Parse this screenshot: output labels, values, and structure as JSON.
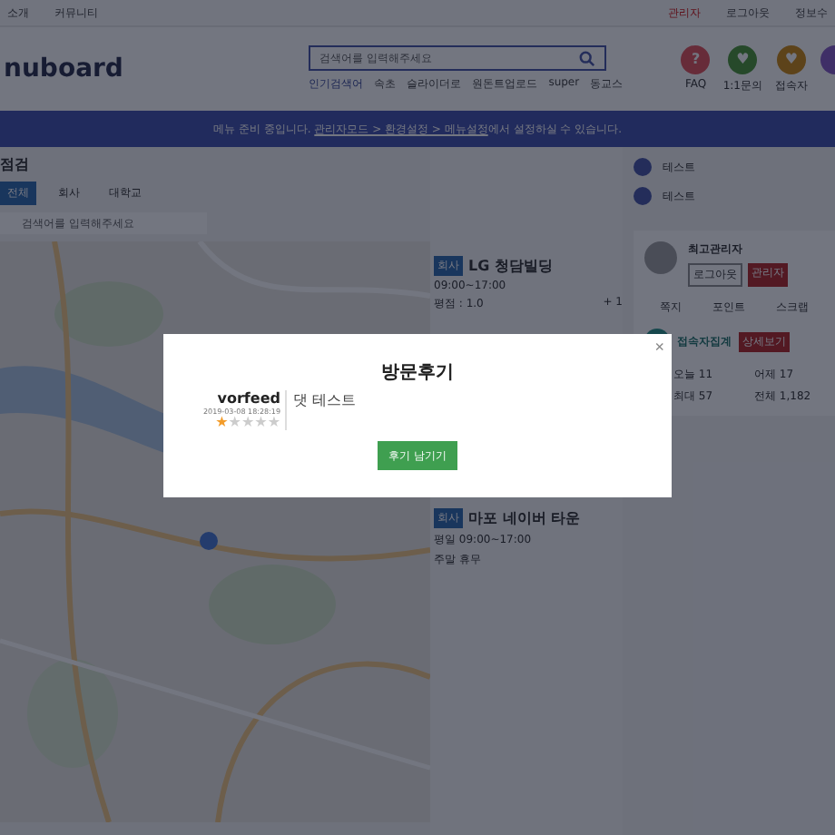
{
  "top_bar": {
    "left_links": [
      "소개",
      "커뮤니티"
    ],
    "right_links": [
      {
        "label": "관리자",
        "kind": "admin"
      },
      {
        "label": "로그아웃",
        "kind": "plain"
      },
      {
        "label": "정보수",
        "kind": "plain"
      }
    ]
  },
  "header": {
    "logo": "nuboard",
    "search": {
      "placeholder": "검색어를 입력해주세요"
    },
    "popular": [
      "인기검색어",
      "속초",
      "슬라이더로",
      "원돈트업로드",
      "super",
      "동교스"
    ],
    "quick_links": [
      {
        "label": "FAQ",
        "glyph": "?"
      },
      {
        "label": "1:1문의",
        "glyph": "♥"
      },
      {
        "label": "접속자",
        "glyph": "♥"
      }
    ]
  },
  "banner": {
    "text": "메뉴 준비 중입니다.",
    "links": [
      "관리자모드 > 환경설정 > 메뉴설정"
    ],
    "tail": "에서 설정하실 수 있습니다."
  },
  "left": {
    "title": "점검",
    "tabs": [
      {
        "label": "전체",
        "selected": true
      },
      {
        "label": "회사",
        "selected": false
      },
      {
        "label": "대학교",
        "selected": false
      }
    ],
    "search": {
      "placeholder": "검색어를 입력해주세요"
    }
  },
  "places": [
    {
      "tag": "회사",
      "name": "LG 청담빌딩",
      "hours": [
        "09:00~17:00"
      ],
      "rating": "평점 : 1.0",
      "count": "+ 1"
    },
    {
      "tag": "회사",
      "name": "마포 네이버 타운",
      "hours": [
        "평일 09:00~17:00",
        "주말 휴무"
      ]
    }
  ],
  "sidebar": {
    "notices": [
      "테스트",
      "테스트"
    ],
    "member": "최고관리자",
    "logout": "로그아웃",
    "admin": "관리자",
    "stats": [
      "쪽지",
      "포인트",
      "스크랩"
    ],
    "visitors": {
      "title": "접속자집계",
      "more": "상세보기",
      "rows": [
        {
          "label": "오늘",
          "value": "11"
        },
        {
          "label": "어제",
          "value": "17"
        },
        {
          "label": "최대",
          "value": "57"
        },
        {
          "label": "전체",
          "value": "1,182"
        }
      ]
    }
  },
  "modal": {
    "title": "방문후기",
    "close": "×",
    "author": "vorfeed",
    "date": "2019-03-08 18:28:19",
    "stars": 1,
    "comment": "댓 테스트",
    "button": "후기 남기기"
  }
}
